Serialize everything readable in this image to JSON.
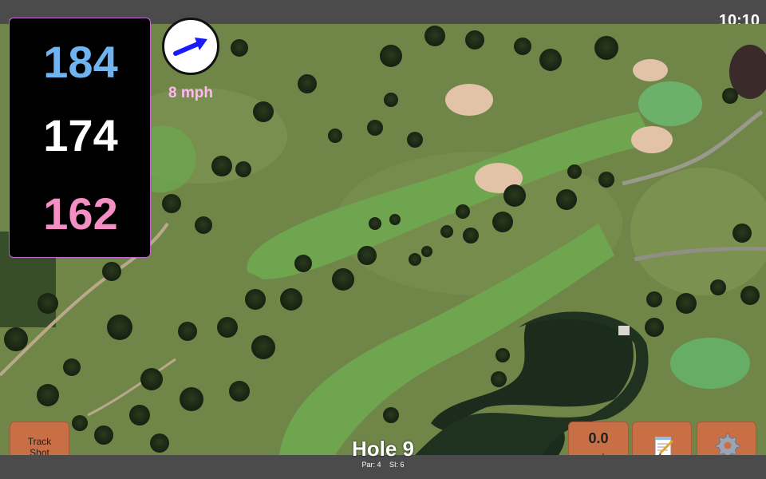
{
  "status_bar": {
    "time": "10:10"
  },
  "distances": {
    "back": "184",
    "middle": "174",
    "front": "162"
  },
  "wind": {
    "speed_label": "8 mph",
    "arrow_icon": "arrow-right-icon",
    "color": "#1a1aff"
  },
  "buttons": {
    "track_shot": "Track\nShot",
    "speed_value": "0.0",
    "speed_unit": "mph",
    "notes_icon": "notepad-icon",
    "settings_icon": "gear-icon"
  },
  "hole": {
    "title": "Hole 9",
    "par": "Par: 4",
    "si": "SI: 6"
  },
  "colors": {
    "back_distance": "#6fb3f0",
    "middle_distance": "#ffffff",
    "front_distance": "#f48ec4",
    "button_orange": "#c86f45"
  }
}
